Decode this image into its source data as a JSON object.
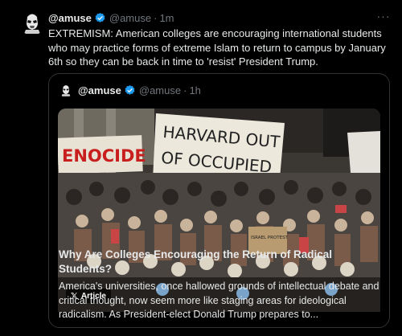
{
  "tweet": {
    "author_name": "@amuse",
    "author_handle": "@amuse",
    "separator": "·",
    "time": "1m",
    "more_label": "···",
    "text": "EXTREMISM: American colleges are encouraging international students who may practice forms of extreme Islam to return to campus by January 6th so they can be back in time to 'resist' President Trump."
  },
  "quote": {
    "author_name": "@amuse",
    "author_handle": "@amuse",
    "separator": "·",
    "time": "1h",
    "article_badge": "Article",
    "title": "Why Are Colleges Encouraging the Return of Radical Students?",
    "description": "America's universities, once hallowed grounds of intellectual debate and critical thought, now seem more like staging areas for ideological radicalism. As President-elect Donald Trump prepares to...",
    "image": {
      "sign_top_left": "ENOCIDE",
      "sign_main_line1": "HARVARD OUT",
      "sign_main_line2": "OF OCCUPIED",
      "sign_bottom": "ISRAEL PROTEST"
    }
  },
  "colors": {
    "background": "#000000",
    "text": "#e7e9ea",
    "muted": "#71767b",
    "verified": "#1d9bf0",
    "border": "#2f3336"
  },
  "icons": [
    "avatar-stormtrooper",
    "verified-badge-icon",
    "more-options-icon",
    "x-logo-icon"
  ]
}
